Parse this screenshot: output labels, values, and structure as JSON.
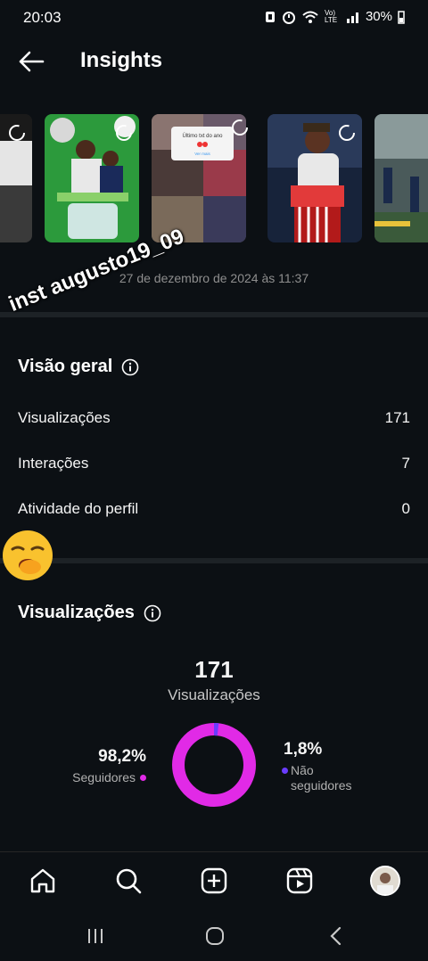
{
  "status_bar": {
    "time": "20:03",
    "network_label": "Vo) LTE",
    "battery": "30%"
  },
  "header": {
    "title": "Insights"
  },
  "stories": [
    {
      "name": "story-1",
      "bg": "#2b2b2b"
    },
    {
      "name": "story-2",
      "bg": "#2f8f3a"
    },
    {
      "name": "story-3",
      "bg": "#6a5a5a"
    },
    {
      "name": "story-4",
      "bg": "#1d2a4a"
    },
    {
      "name": "story-5",
      "bg": "#3e5a6a"
    }
  ],
  "story_card_text": {
    "title": "Último txt do ano",
    "button": "Ver mais"
  },
  "post_date": "27 de dezembro de 2024 às 11:37",
  "overlay_text": "inst augusto19_09",
  "overview": {
    "title": "Visão geral",
    "rows": [
      {
        "label": "Visualizações",
        "value": "171"
      },
      {
        "label": "Interações",
        "value": "7"
      },
      {
        "label": "Atividade do perfil",
        "value": "0"
      }
    ]
  },
  "views": {
    "title": "Visualizações",
    "total": "171",
    "total_label": "Visualizações",
    "followers_pct": "98,2%",
    "followers_label": "Seguidores",
    "non_followers_pct": "1,8%",
    "non_followers_label": "Não seguidores",
    "followers_fraction": 0.982,
    "colors": {
      "followers": "#e12ae6",
      "non_followers": "#6a3cff"
    }
  },
  "bottom_nav": [
    "home-icon",
    "search-icon",
    "create-icon",
    "reels-icon",
    "profile-avatar"
  ],
  "system_nav": [
    "recents-icon",
    "home-circle-icon",
    "back-chevron-icon"
  ]
}
